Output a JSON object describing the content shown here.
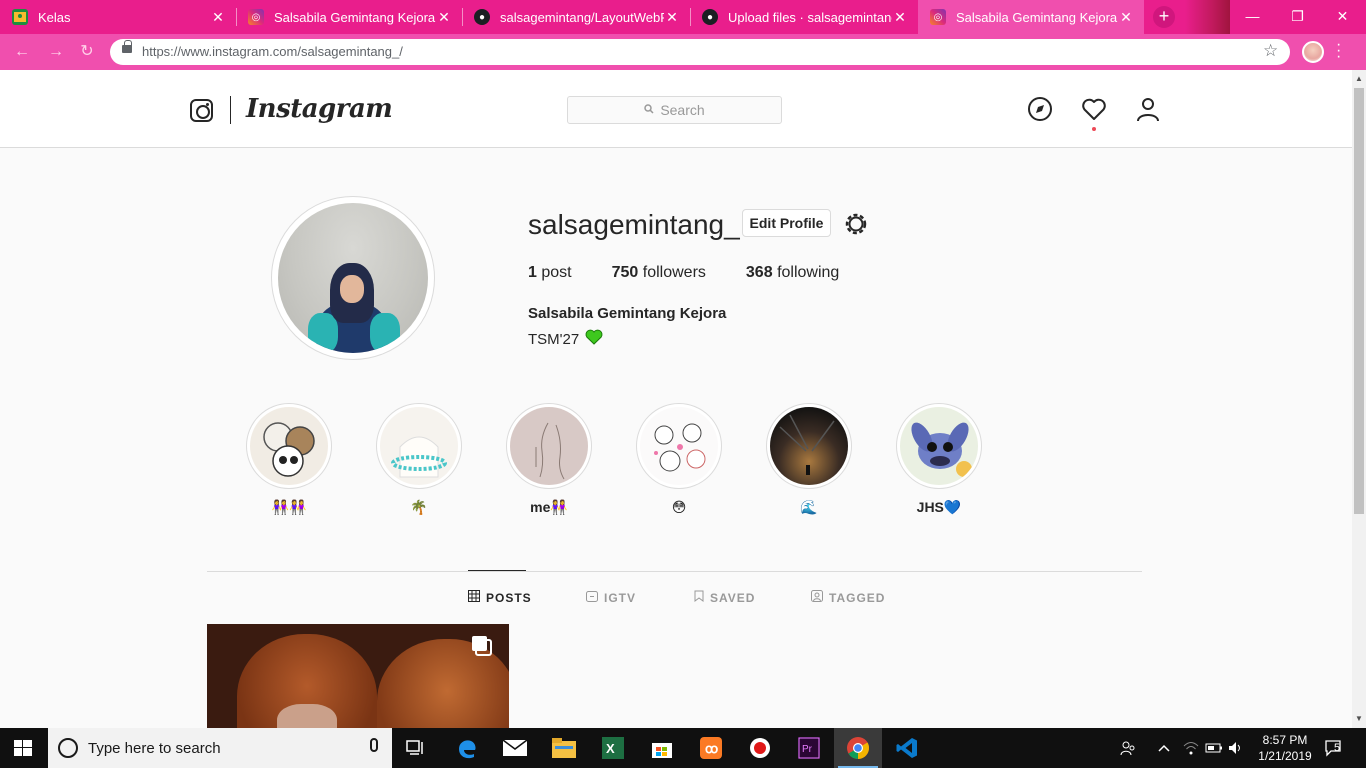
{
  "browser": {
    "tabs": [
      {
        "title": "Kelas",
        "favicon": "classroom-icon"
      },
      {
        "title": "Salsabila Gemintang Kejora (@",
        "favicon": "instagram-icon"
      },
      {
        "title": "salsagemintang/LayoutWebPro",
        "favicon": "github-icon"
      },
      {
        "title": "Upload files · salsagemintang/L",
        "favicon": "github-icon"
      },
      {
        "title": "Salsabila Gemintang Kejora (@",
        "favicon": "instagram-icon",
        "active": true
      }
    ],
    "url_host": "https://www.instagram.com/",
    "url_path": "salsagemintang_/",
    "accent_color": "#e91e8c"
  },
  "instagram": {
    "wordmark": "Instagram",
    "search_placeholder": "Search",
    "profile": {
      "username": "salsagemintang_",
      "edit_label": "Edit Profile",
      "posts_count": "1",
      "posts_label": "post",
      "followers_count": "750",
      "followers_label": "followers",
      "following_count": "368",
      "following_label": "following",
      "full_name": "Salsabila Gemintang Kejora",
      "bio": "TSM'27"
    },
    "highlights": [
      {
        "label": "👭👭"
      },
      {
        "label": "🌴"
      },
      {
        "label": "me👭"
      },
      {
        "label": "😳"
      },
      {
        "label": "🌊"
      },
      {
        "label": "JHS💙"
      }
    ],
    "tabs": [
      {
        "label": "POSTS",
        "icon": "grid-icon",
        "active": true
      },
      {
        "label": "IGTV",
        "icon": "igtv-icon"
      },
      {
        "label": "SAVED",
        "icon": "bookmark-icon"
      },
      {
        "label": "TAGGED",
        "icon": "tagged-icon"
      }
    ]
  },
  "taskbar": {
    "search_placeholder": "Type here to search",
    "time": "8:57 PM",
    "date": "1/21/2019",
    "notifications": "5"
  }
}
